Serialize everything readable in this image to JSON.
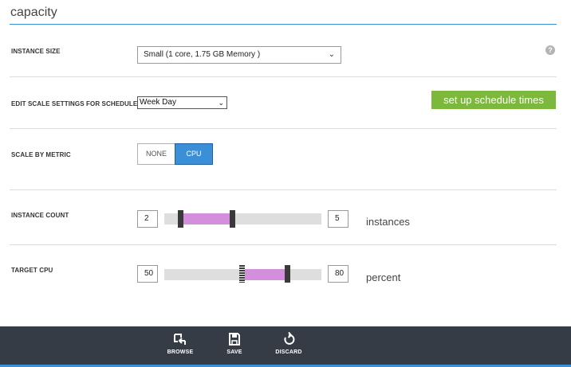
{
  "page": {
    "title": "capacity"
  },
  "instance_size": {
    "label": "INSTANCE SIZE",
    "selected": "Small (1 core, 1.75 GB Memory )",
    "help_icon": "question-icon"
  },
  "schedule": {
    "label": "EDIT SCALE SETTINGS FOR SCHEDULE",
    "selected": "Week Day",
    "button_label": "set up schedule times"
  },
  "scale_by_metric": {
    "label": "SCALE BY METRIC",
    "options": [
      "NONE",
      "CPU"
    ],
    "selected": "CPU"
  },
  "instance_count": {
    "label": "INSTANCE COUNT",
    "min": 2,
    "max": 5,
    "min_text": "2",
    "max_text": "5",
    "unit": "instances"
  },
  "target_cpu": {
    "label": "TARGET CPU",
    "min": 50,
    "max": 80,
    "min_text": "50",
    "max_text": "80",
    "unit": "percent"
  },
  "footer": {
    "buttons": [
      {
        "label": "BROWSE",
        "icon": "browse-icon"
      },
      {
        "label": "SAVE",
        "icon": "save-icon"
      },
      {
        "label": "DISCARD",
        "icon": "discard-icon"
      }
    ]
  },
  "colors": {
    "accent": "#3b8fd6",
    "button_green": "#7bb83c",
    "range": "#d48fdc",
    "footer_bg": "#353c46"
  }
}
